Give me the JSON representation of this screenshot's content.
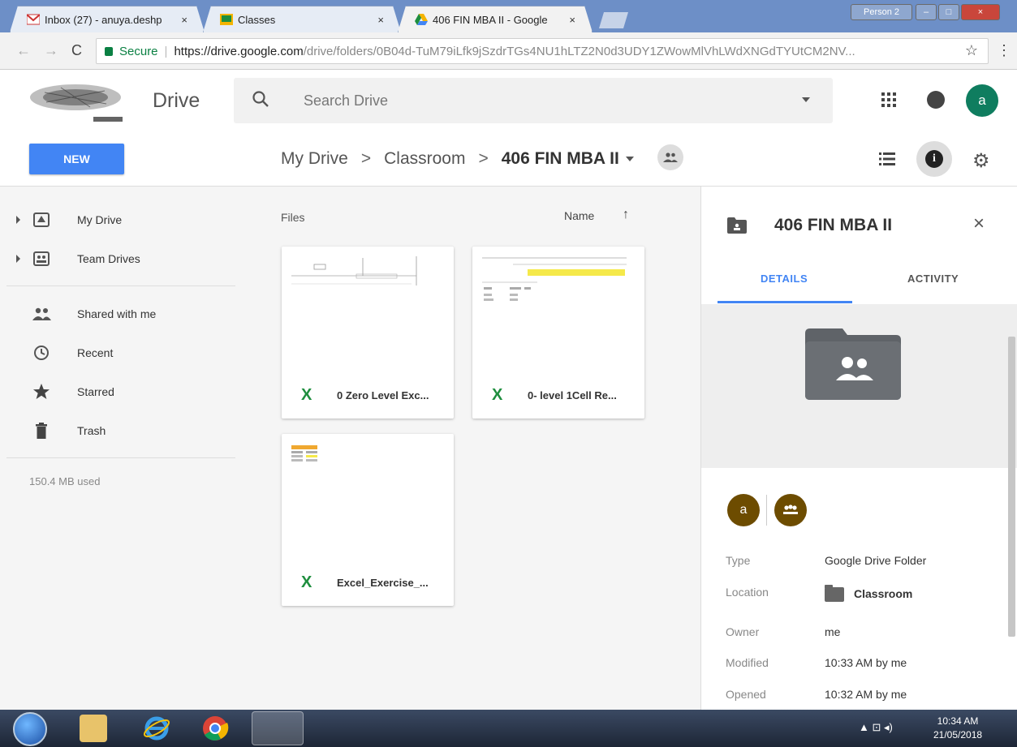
{
  "browser": {
    "tabs": [
      {
        "title": "Inbox (27) - anuya.deshp",
        "close": "×"
      },
      {
        "title": "Classes",
        "close": "×"
      },
      {
        "title": "406 FIN MBA II - Google",
        "close": "×"
      }
    ],
    "window_buttons": {
      "profile": "Person 2",
      "minimize": "–",
      "maximize": "□",
      "close": "×"
    },
    "secure_label": "Secure",
    "url_host": "https://drive.google.com",
    "url_path": "/drive/folders/0B04d-TuM79iLfk9jSzdrTGs4NU1hLTZ2N0d3UDY1ZWowMlVhLWdXNGdTYUtCM2NV...",
    "star": "☆",
    "menu": "⋮"
  },
  "header": {
    "app_name": "Drive",
    "search_placeholder": "Search Drive",
    "account_initial": "a"
  },
  "toolbar": {
    "new_label": "NEW",
    "breadcrumbs": [
      "My Drive",
      "Classroom",
      "406 FIN MBA II"
    ],
    "chevron": ">"
  },
  "sidebar": {
    "items": [
      {
        "label": "My Drive"
      },
      {
        "label": "Team Drives"
      },
      {
        "label": "Shared with me"
      },
      {
        "label": "Recent"
      },
      {
        "label": "Starred"
      },
      {
        "label": "Trash"
      }
    ],
    "storage": "150.4 MB used"
  },
  "main": {
    "section_label": "Files",
    "sort_label": "Name",
    "sort_arrow": "↑",
    "files": [
      {
        "name": "0 Zero Level Exc...",
        "type_icon": "X"
      },
      {
        "name": "0- level 1Cell Re...",
        "type_icon": "X"
      },
      {
        "name": "Excel_Exercise_...",
        "type_icon": "X"
      }
    ]
  },
  "details": {
    "title": "406 FIN MBA II",
    "close": "×",
    "tabs": [
      "DETAILS",
      "ACTIVITY"
    ],
    "owner_initial": "a",
    "rows": [
      {
        "key": "Type",
        "value": "Google Drive Folder"
      },
      {
        "key": "Location",
        "value": "Classroom"
      },
      {
        "key": "Owner",
        "value": "me"
      },
      {
        "key": "Modified",
        "value": "10:33 AM by me"
      },
      {
        "key": "Opened",
        "value": "10:32 AM by me"
      }
    ]
  },
  "taskbar": {
    "time": "10:34 AM",
    "date": "21/05/2018",
    "tray": "▲ ⊡ ◂)"
  },
  "colors": {
    "accent_blue": "#4285f4",
    "account_green": "#0f7d5f",
    "excel_green": "#1e8e3e",
    "owner_brown": "#6d4c00"
  }
}
